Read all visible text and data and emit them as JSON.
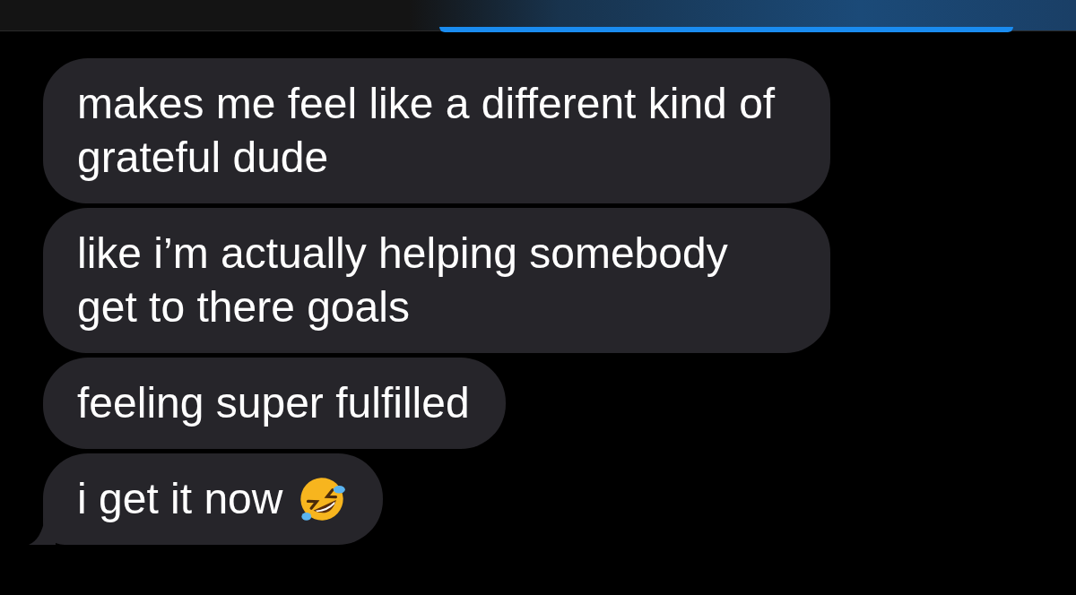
{
  "messages": [
    {
      "text": "makes me feel like a different kind of grateful dude",
      "tail": false,
      "emoji": false
    },
    {
      "text": "like i’m actually helping somebody get to there goals",
      "tail": false,
      "emoji": false
    },
    {
      "text": "feeling super fulfilled",
      "tail": false,
      "emoji": false
    },
    {
      "text": "i get it now",
      "tail": true,
      "emoji": true
    }
  ]
}
